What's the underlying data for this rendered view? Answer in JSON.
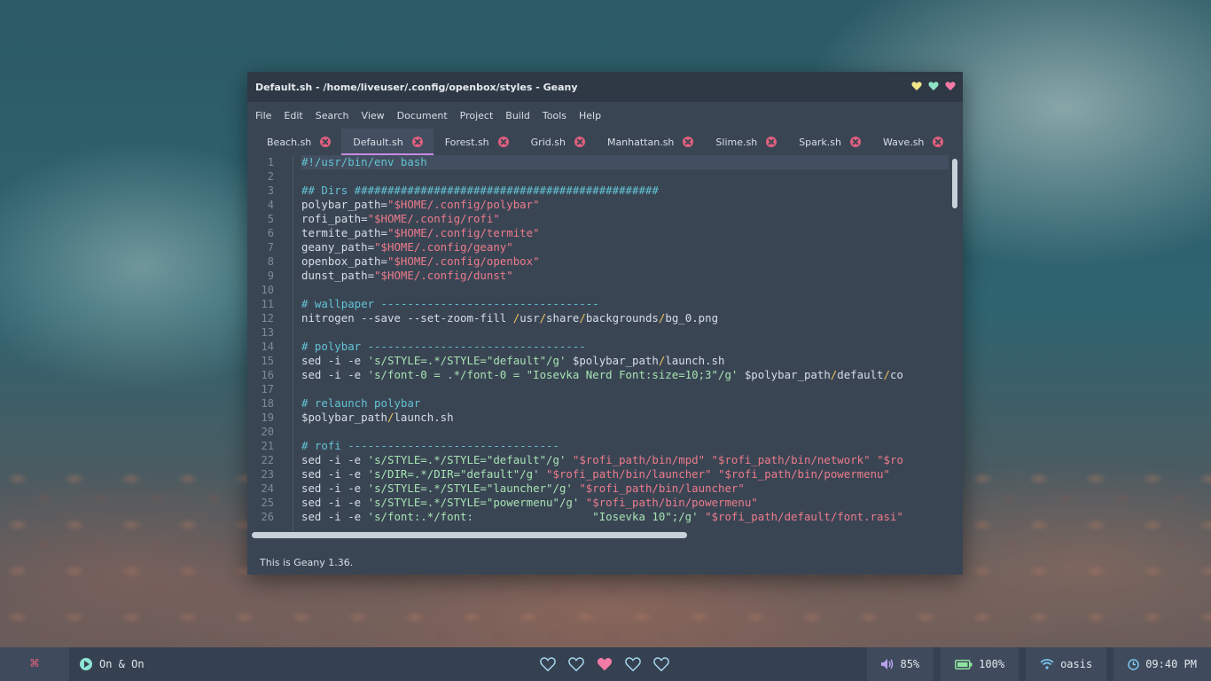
{
  "window": {
    "title": "Default.sh - /home/liveuser/.config/openbox/styles - Geany",
    "buttons": [
      {
        "name": "minimize",
        "color": "#f2e58a"
      },
      {
        "name": "maximize",
        "color": "#8fe3c5"
      },
      {
        "name": "close",
        "color": "#f27ba6"
      }
    ]
  },
  "menu": [
    "File",
    "Edit",
    "Search",
    "View",
    "Document",
    "Project",
    "Build",
    "Tools",
    "Help"
  ],
  "tabs": [
    {
      "label": "Beach.sh",
      "active": false
    },
    {
      "label": "Default.sh",
      "active": true
    },
    {
      "label": "Forest.sh",
      "active": false
    },
    {
      "label": "Grid.sh",
      "active": false
    },
    {
      "label": "Manhattan.sh",
      "active": false
    },
    {
      "label": "Slime.sh",
      "active": false
    },
    {
      "label": "Spark.sh",
      "active": false
    },
    {
      "label": "Wave.sh",
      "active": false
    }
  ],
  "editor": {
    "lines": [
      [
        [
          "c-com",
          "#!/usr/bin/env bash"
        ]
      ],
      [],
      [
        [
          "c-com",
          "## Dirs ##############################################"
        ]
      ],
      [
        [
          "c-op",
          "polybar_path="
        ],
        [
          "c-str",
          "\"$HOME/.config/polybar\""
        ]
      ],
      [
        [
          "c-op",
          "rofi_path="
        ],
        [
          "c-str",
          "\"$HOME/.config/rofi\""
        ]
      ],
      [
        [
          "c-op",
          "termite_path="
        ],
        [
          "c-str",
          "\"$HOME/.config/termite\""
        ]
      ],
      [
        [
          "c-op",
          "geany_path="
        ],
        [
          "c-str",
          "\"$HOME/.config/geany\""
        ]
      ],
      [
        [
          "c-op",
          "openbox_path="
        ],
        [
          "c-str",
          "\"$HOME/.config/openbox\""
        ]
      ],
      [
        [
          "c-op",
          "dunst_path="
        ],
        [
          "c-str",
          "\"$HOME/.config/dunst\""
        ]
      ],
      [],
      [
        [
          "c-com",
          "# wallpaper ---------------------------------"
        ]
      ],
      [
        [
          "c-op",
          "nitrogen --save --set-zoom-fill "
        ],
        [
          "c-sl",
          "/"
        ],
        [
          "c-op",
          "usr"
        ],
        [
          "c-sl",
          "/"
        ],
        [
          "c-op",
          "share"
        ],
        [
          "c-sl",
          "/"
        ],
        [
          "c-op",
          "backgrounds"
        ],
        [
          "c-sl",
          "/"
        ],
        [
          "c-op",
          "bg_0.png"
        ]
      ],
      [],
      [
        [
          "c-com",
          "# polybar ---------------------------------"
        ]
      ],
      [
        [
          "c-op",
          "sed -i -e "
        ],
        [
          "c-str2",
          "'s/STYLE=.*/STYLE=\"default\"/g'"
        ],
        [
          "c-op",
          " $polybar_path"
        ],
        [
          "c-sl",
          "/"
        ],
        [
          "c-op",
          "launch.sh"
        ]
      ],
      [
        [
          "c-op",
          "sed -i -e "
        ],
        [
          "c-str2",
          "'s/font-0 = .*/font-0 = \"Iosevka Nerd Font:size=10;3\"/g'"
        ],
        [
          "c-op",
          " $polybar_path"
        ],
        [
          "c-sl",
          "/"
        ],
        [
          "c-op",
          "default"
        ],
        [
          "c-sl",
          "/"
        ],
        [
          "c-op",
          "co"
        ]
      ],
      [],
      [
        [
          "c-com",
          "# relaunch polybar"
        ]
      ],
      [
        [
          "c-op",
          "$polybar_path"
        ],
        [
          "c-sl",
          "/"
        ],
        [
          "c-op",
          "launch.sh"
        ]
      ],
      [],
      [
        [
          "c-com",
          "# rofi --------------------------------"
        ]
      ],
      [
        [
          "c-op",
          "sed -i -e "
        ],
        [
          "c-str2",
          "'s/STYLE=.*/STYLE=\"default\"/g'"
        ],
        [
          "c-op",
          " "
        ],
        [
          "c-str",
          "\"$rofi_path/bin/mpd\""
        ],
        [
          "c-op",
          " "
        ],
        [
          "c-str",
          "\"$rofi_path/bin/network\""
        ],
        [
          "c-op",
          " "
        ],
        [
          "c-str",
          "\"$ro"
        ]
      ],
      [
        [
          "c-op",
          "sed -i -e "
        ],
        [
          "c-str2",
          "'s/DIR=.*/DIR=\"default\"/g'"
        ],
        [
          "c-op",
          " "
        ],
        [
          "c-str",
          "\"$rofi_path/bin/launcher\""
        ],
        [
          "c-op",
          " "
        ],
        [
          "c-str",
          "\"$rofi_path/bin/powermenu\""
        ]
      ],
      [
        [
          "c-op",
          "sed -i -e "
        ],
        [
          "c-str2",
          "'s/STYLE=.*/STYLE=\"launcher\"/g'"
        ],
        [
          "c-op",
          " "
        ],
        [
          "c-str",
          "\"$rofi_path/bin/launcher\""
        ]
      ],
      [
        [
          "c-op",
          "sed -i -e "
        ],
        [
          "c-str2",
          "'s/STYLE=.*/STYLE=\"powermenu\"/g'"
        ],
        [
          "c-op",
          " "
        ],
        [
          "c-str",
          "\"$rofi_path/bin/powermenu\""
        ]
      ],
      [
        [
          "c-op",
          "sed -i -e "
        ],
        [
          "c-str2",
          "'s/font:.*/font:                  "
        ],
        [
          "c-str2",
          "\"Iosevka 10\";/g'"
        ],
        [
          "c-op",
          " "
        ],
        [
          "c-str",
          "\"$rofi_path/default/font.rasi\""
        ]
      ]
    ],
    "line_numbers": [
      "1",
      "2",
      "3",
      "4",
      "5",
      "6",
      "7",
      "8",
      "9",
      "10",
      "11",
      "12",
      "13",
      "14",
      "15",
      "16",
      "17",
      "18",
      "19",
      "20",
      "21",
      "22",
      "23",
      "24",
      "25",
      "26"
    ]
  },
  "status": "This is Geany 1.36.",
  "polybar": {
    "menu_icon": "⌘",
    "mpd": "On & On",
    "workspaces": [
      {
        "filled": false,
        "color": "#a7d8f0"
      },
      {
        "filled": false,
        "color": "#a7d8f0"
      },
      {
        "filled": true,
        "color": "#f27ba6"
      },
      {
        "filled": false,
        "color": "#a7d8f0"
      },
      {
        "filled": false,
        "color": "#a7d8f0"
      }
    ],
    "volume": "85%",
    "battery": "100%",
    "network": "oasis",
    "time": "09:40 PM"
  }
}
